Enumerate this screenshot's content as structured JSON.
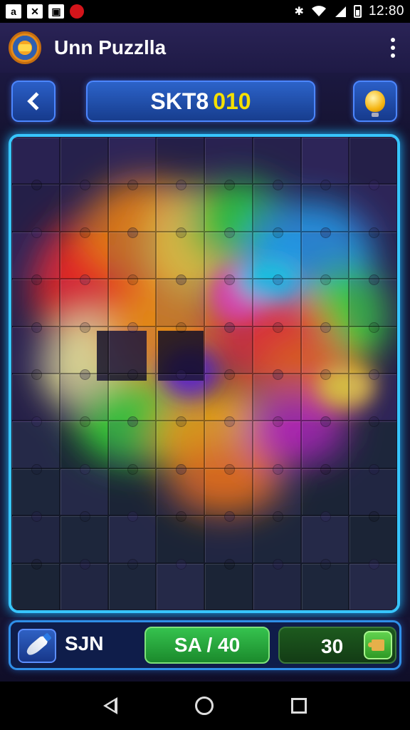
{
  "status_bar": {
    "time": "12:80",
    "left_icons": [
      "a-app-icon",
      "x-app-icon",
      "image-icon",
      "notification-red-icon"
    ],
    "left_glyphs": [
      "a",
      "✕",
      "▣",
      "●"
    ],
    "right_icons": [
      "bluetooth-icon",
      "wifi-icon",
      "signal-icon",
      "battery-icon"
    ]
  },
  "app_bar": {
    "title": "Unn Puzzlla"
  },
  "header": {
    "level_prefix": "SKT8",
    "level_number": "010"
  },
  "board": {
    "columns": 8,
    "rows": 10,
    "colors": {
      "frame": "#38c6ff",
      "background": "#261f49"
    }
  },
  "hud": {
    "score_label": "SJN",
    "pieces_label": "SA / 40",
    "time_label": "30"
  },
  "colors": {
    "accent_blue": "#2b5fc7",
    "accent_green": "#35c24e",
    "level_number": "#f5e000"
  }
}
